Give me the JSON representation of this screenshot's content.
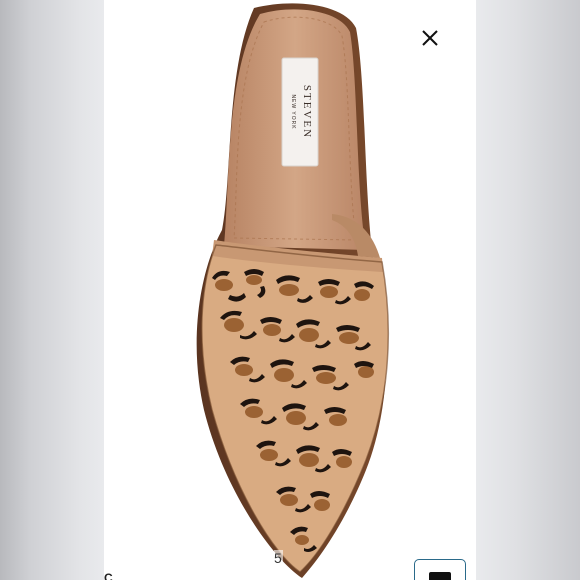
{
  "viewer": {
    "image_counter": "5",
    "close_icon": "close-icon",
    "chat_icon": "message-icon"
  },
  "photo": {
    "insole_brand": "STEVEN",
    "insole_subbrand": "NEW YORK",
    "colors": {
      "insole": "#c89978",
      "print_base": "#d9ab82",
      "spot_dark": "#1e140f",
      "spot_brown": "#9b6233"
    }
  },
  "caption": {
    "text": "C"
  }
}
